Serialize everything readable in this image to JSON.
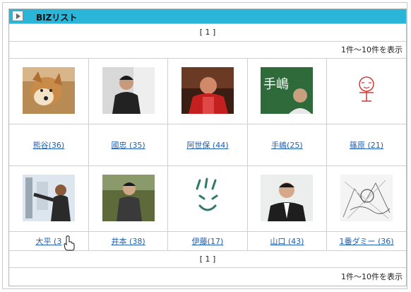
{
  "header": {
    "title": "BIZリスト",
    "play_icon": "play-icon"
  },
  "pager": {
    "top": "[ 1 ]",
    "bottom": "[ 1 ]"
  },
  "count": {
    "top": "1件～10件を表示",
    "bottom": "1件～10件を表示"
  },
  "members": [
    {
      "name": "熊谷(36)",
      "photo": "dog-photo"
    },
    {
      "name": "國忠 (35)",
      "photo": "person-photo"
    },
    {
      "name": "阿世保 (44)",
      "photo": "person-red-photo"
    },
    {
      "name": "手嶋(25)",
      "photo": "person-sign-photo"
    },
    {
      "name": "篠原 (21)",
      "photo": "drawing-photo"
    },
    {
      "name": "大平 (3",
      "photo": "person-window-photo"
    },
    {
      "name": "井本 (38)",
      "photo": "person-outdoor-photo"
    },
    {
      "name": "伊藤(17)",
      "photo": "smiley-drawing"
    },
    {
      "name": "山口 (43)",
      "photo": "person-suit-photo"
    },
    {
      "name": "1番ダミー (36)",
      "photo": "sketch-drawing"
    }
  ],
  "colors": {
    "titlebar": "#2bb5d8",
    "link": "#1f5fb0"
  }
}
